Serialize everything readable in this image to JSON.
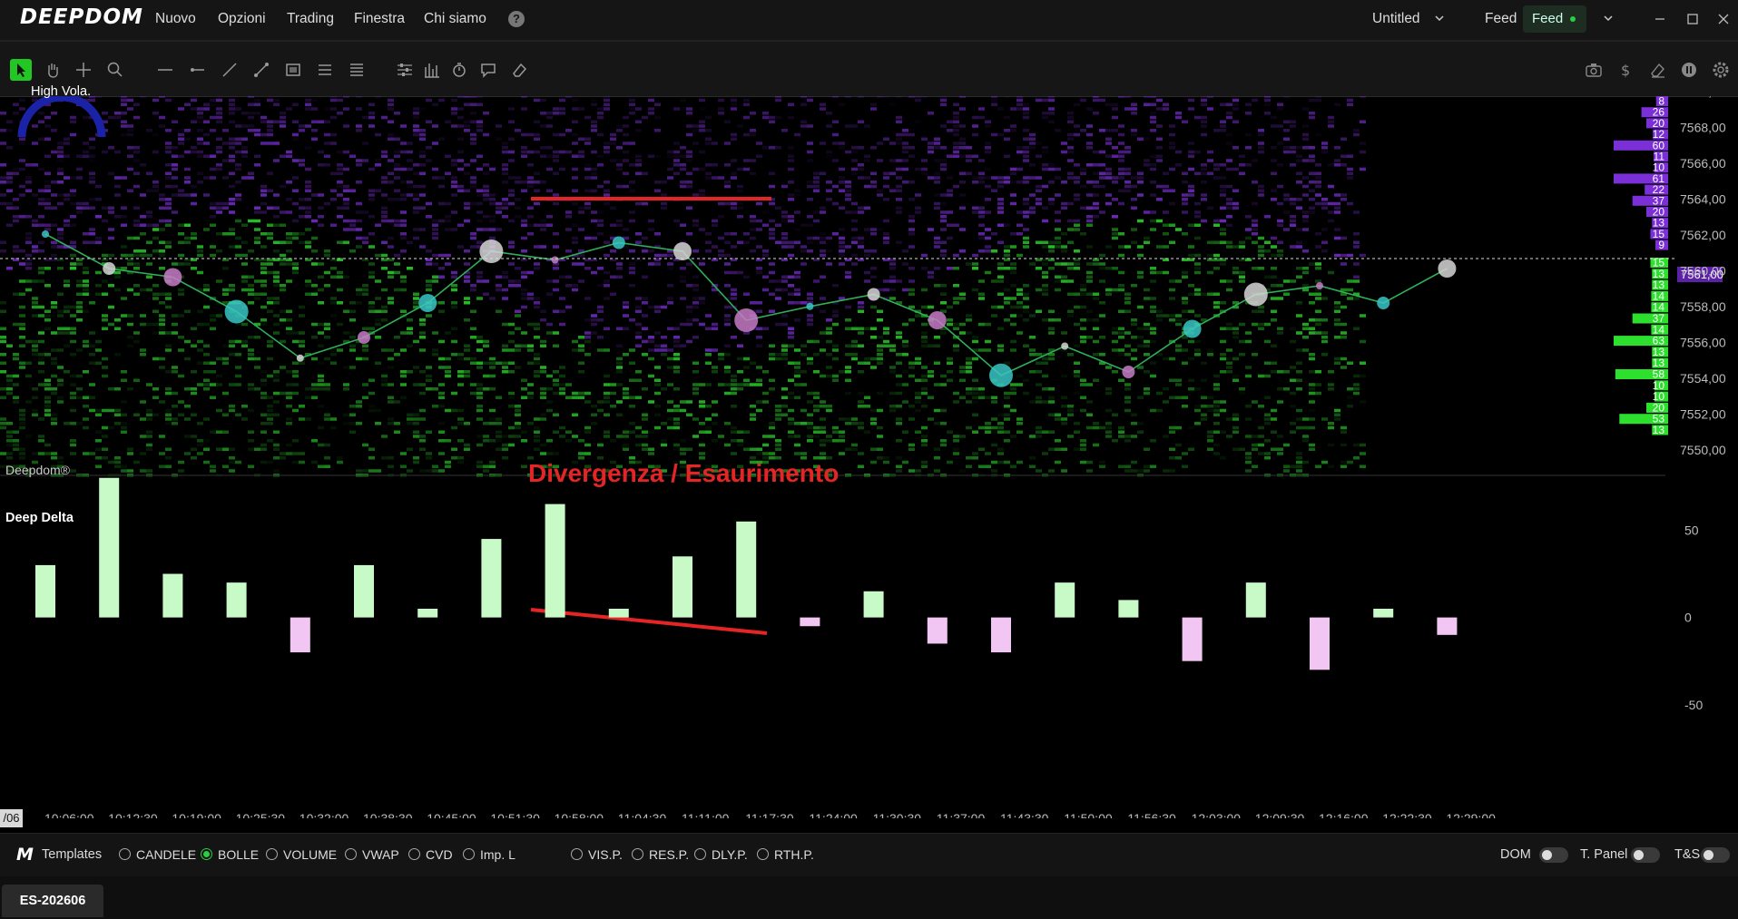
{
  "app": {
    "logo": "DEEPDOM",
    "menu": [
      "Nuovo",
      "Opzioni",
      "Trading",
      "Finestra",
      "Chi siamo"
    ],
    "workspace_title": "Untitled",
    "feed_label": "Feed",
    "feed_button": "Feed",
    "feed_status_color": "#2ecc40"
  },
  "toolbar": {
    "left_tools": [
      "cursor-icon",
      "hand-icon",
      "crosshair-icon",
      "zoom-icon",
      "horizontal-line-icon",
      "ray-icon",
      "trendline-icon",
      "segment-icon",
      "rectangle-icon",
      "fib-icon",
      "parallel-icon",
      "settings-sliders-icon",
      "histogram-icon",
      "timer-icon",
      "comment-icon",
      "eraser-icon"
    ],
    "right_tools": [
      "camera-icon",
      "dollar-icon",
      "erase-all-icon",
      "pause-icon",
      "gear-icon"
    ]
  },
  "chart": {
    "watermark": "Deepdom®",
    "volatility_label": "High Vola.",
    "annotation": "Divergenza / Esaurimento",
    "delta_title": "Deep Delta",
    "date_stub": "/06",
    "current_price_label": "7561,00",
    "price_axis": [
      "7570,00",
      "7568,00",
      "7566,00",
      "7564,00",
      "7562,00",
      "7560,00",
      "7558,00",
      "7556,00",
      "7554,00",
      "7552,00",
      "7550,00"
    ],
    "delta_axis": [
      "50",
      "0",
      "-50"
    ],
    "time_axis": [
      "10:06:00",
      "10:12:30",
      "10:19:00",
      "10:25:30",
      "10:32:00",
      "10:38:30",
      "10:45:00",
      "10:51:30",
      "10:58:00",
      "11:04:30",
      "11:11:00",
      "11:17:30",
      "11:24:00",
      "11:30:30",
      "11:37:00",
      "11:43:30",
      "11:50:00",
      "11:56:30",
      "12:03:00",
      "12:09:30",
      "12:16:00",
      "12:22:30",
      "12:29:00"
    ],
    "ask_volumes": [
      "8",
      "26",
      "20",
      "12",
      "60",
      "11",
      "10",
      "61",
      "22",
      "37",
      "20",
      "13",
      "15",
      "9"
    ],
    "bid_volumes": [
      "15",
      "13",
      "13",
      "14",
      "14",
      "37",
      "14",
      "63",
      "13",
      "13",
      "58",
      "10",
      "10",
      "20",
      "53",
      "13"
    ],
    "colors": {
      "ask": "#7b2fd6",
      "bid": "#2ee02e",
      "price_line": "#2fae5a",
      "annotation": "#e52525",
      "delta_pos": "#c8fac8",
      "delta_neg": "#f2c6f2"
    }
  },
  "chart_data": {
    "type": "line",
    "title": "",
    "xlabel": "",
    "ylabel": "",
    "x": [
      "10:06:00",
      "10:12:30",
      "10:19:00",
      "10:25:30",
      "10:32:00",
      "10:38:30",
      "10:45:00",
      "10:51:30",
      "10:58:00",
      "11:04:30",
      "11:11:00",
      "11:17:30",
      "11:24:00",
      "11:30:30",
      "11:37:00",
      "11:43:30",
      "11:50:00",
      "11:56:30",
      "12:03:00",
      "12:09:30",
      "12:16:00",
      "12:22:30",
      "12:29:00"
    ],
    "series": [
      {
        "values": [
          7563.0,
          7561.0,
          7560.5,
          7558.5,
          7555.8,
          7557.0,
          7559.0,
          7562.0,
          7561.5,
          7562.5,
          7562.0,
          7558.0,
          7558.8,
          7559.5,
          7558.0,
          7554.8,
          7556.5,
          7555.0,
          7557.5,
          7559.5,
          7560.0,
          7559.0,
          7561.0
        ]
      }
    ],
    "ylim": [
      7549,
      7571
    ],
    "delta": {
      "x": [
        "10:06:00",
        "10:12:30",
        "10:19:00",
        "10:25:30",
        "10:32:00",
        "10:38:30",
        "10:45:00",
        "10:51:30",
        "10:58:00",
        "11:04:30",
        "11:11:00",
        "11:17:30",
        "11:24:00",
        "11:30:30",
        "11:37:00",
        "11:43:30",
        "11:50:00",
        "11:56:30",
        "12:03:00",
        "12:09:30",
        "12:16:00",
        "12:22:30",
        "12:29:00"
      ],
      "values": [
        30,
        80,
        25,
        20,
        -20,
        30,
        5,
        45,
        65,
        5,
        35,
        55,
        -5,
        15,
        -15,
        -20,
        20,
        10,
        -25,
        20,
        -30,
        5,
        -10
      ],
      "ylim": [
        -60,
        70
      ]
    }
  }
}
